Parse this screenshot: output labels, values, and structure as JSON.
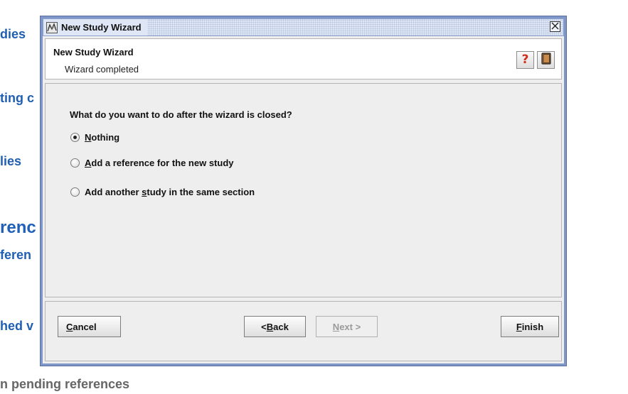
{
  "background": {
    "fragments": [
      "dies",
      "ting c",
      "lies",
      "renc",
      "feren",
      "hed v",
      "n pending references"
    ]
  },
  "window": {
    "title": "New Study Wizard",
    "close_symbol": "✕"
  },
  "header": {
    "title": "New Study Wizard",
    "subtitle": "Wizard completed",
    "help_icon_text": "?"
  },
  "body": {
    "question": "What do you want to do after the wizard is closed?",
    "options": [
      {
        "before": "",
        "mnemonic": "N",
        "after": "othing",
        "selected": true
      },
      {
        "before": "",
        "mnemonic": "A",
        "after": "dd a reference for the new study",
        "selected": false
      },
      {
        "before": "Add another ",
        "mnemonic": "s",
        "after": "tudy in the same section",
        "selected": false
      }
    ]
  },
  "footer": {
    "cancel": {
      "mnemonic": "C",
      "after": "ancel"
    },
    "back": {
      "before": "< ",
      "mnemonic": "B",
      "after": "ack"
    },
    "next": {
      "before": "",
      "mnemonic": "N",
      "after": "ext >",
      "enabled": false
    },
    "finish": {
      "mnemonic": "F",
      "after": "inish"
    }
  },
  "colors": {
    "background_link_blue": "#1f5fb3",
    "window_frame": "#7f97c8",
    "help_red": "#d42a1a",
    "book_brown": "#b9763b"
  }
}
